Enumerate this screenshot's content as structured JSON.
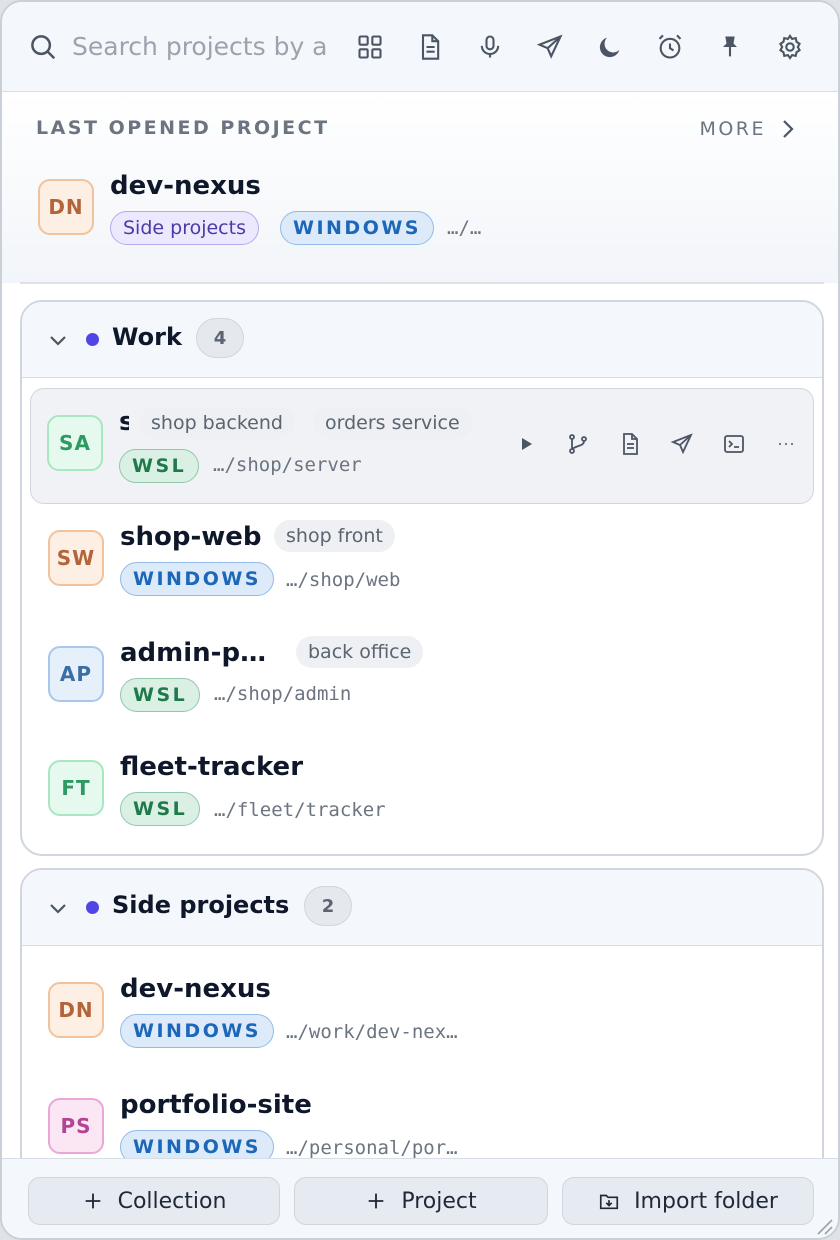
{
  "search": {
    "placeholder": "Search projects by a"
  },
  "toolbar": {
    "icons": [
      "grid-icon",
      "document-icon",
      "microphone-icon",
      "send-icon",
      "moon-icon",
      "alarm-icon",
      "pin-icon",
      "gear-icon"
    ]
  },
  "last_opened": {
    "label": "LAST OPENED PROJECT",
    "more_label": "MORE",
    "project": {
      "initials": "DN",
      "name": "dev-nexus",
      "collection": "Side projects",
      "platform": "WINDOWS",
      "path": "…/…"
    }
  },
  "collections": [
    {
      "name": "Work",
      "count": "4",
      "dot_color": "#4f46e5",
      "projects": [
        {
          "initials": "SA",
          "name": "s",
          "tags": [
            "shop backend",
            "orders service"
          ],
          "platform": "WSL",
          "path": "…/shop/server"
        },
        {
          "initials": "SW",
          "name": "shop-web",
          "tags": [
            "shop front"
          ],
          "platform": "WINDOWS",
          "path": "…/shop/web"
        },
        {
          "initials": "AP",
          "name": "admin-p…",
          "tags": [
            "back office"
          ],
          "platform": "WSL",
          "path": "…/shop/admin"
        },
        {
          "initials": "FT",
          "name": "fleet-tracker",
          "tags": [],
          "platform": "WSL",
          "path": "…/fleet/tracker"
        }
      ]
    },
    {
      "name": "Side projects",
      "count": "2",
      "dot_color": "#4f46e5",
      "projects": [
        {
          "initials": "DN",
          "name": "dev-nexus",
          "tags": [],
          "platform": "WINDOWS",
          "path": "…/work/dev-nex…"
        },
        {
          "initials": "PS",
          "name": "portfolio-site",
          "tags": [],
          "platform": "WINDOWS",
          "path": "…/personal/por…"
        }
      ]
    }
  ],
  "row_actions": [
    "play-icon",
    "branch-icon",
    "document-icon",
    "send-icon",
    "terminal-icon",
    "more-icon"
  ],
  "bottom": {
    "collection_label": "Collection",
    "project_label": "Project",
    "import_label": "Import folder"
  },
  "colors": {
    "accent": "#4f46e5",
    "windows_chip": "#1d67b8",
    "wsl_chip": "#1f7a4a"
  }
}
